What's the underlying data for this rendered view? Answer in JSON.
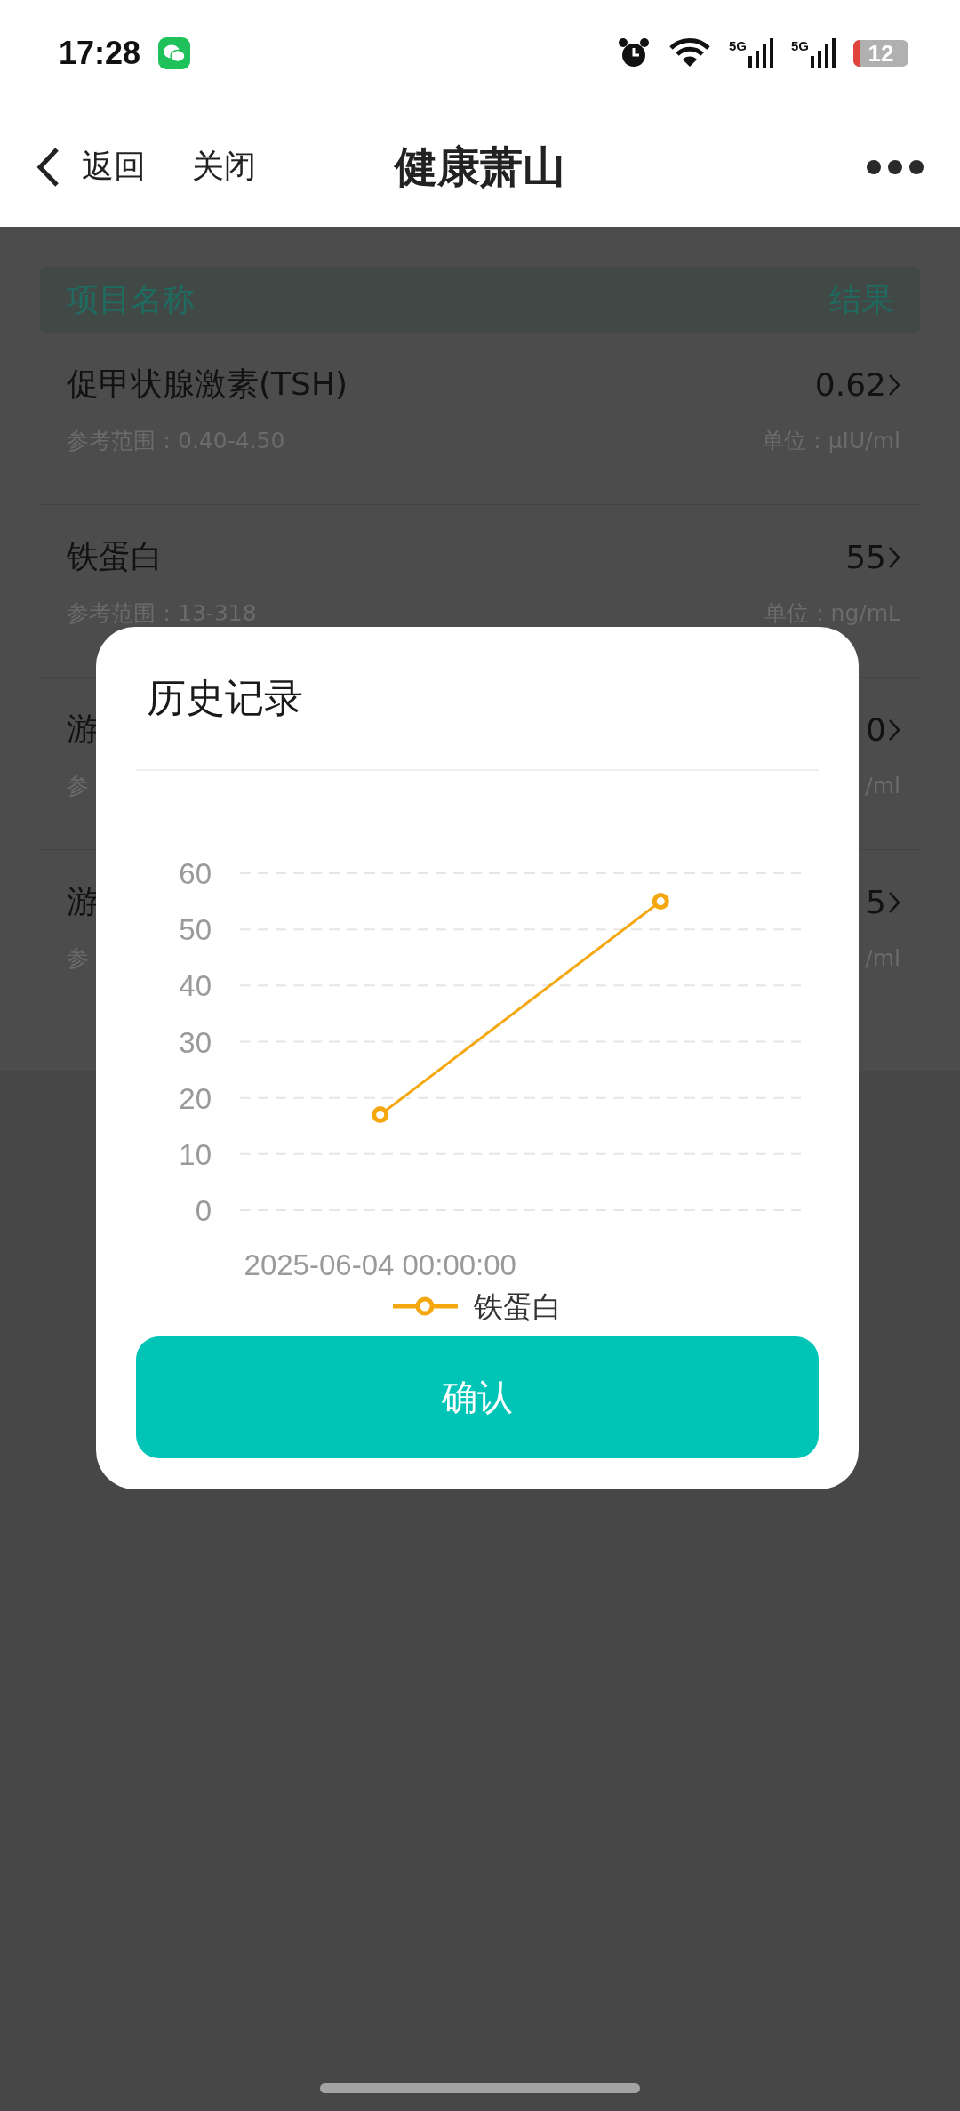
{
  "status_bar": {
    "time": "17:28",
    "network_labels": [
      "5G",
      "5G"
    ],
    "battery": "12"
  },
  "nav": {
    "back": "返回",
    "close": "关闭",
    "title": "健康萧山"
  },
  "table": {
    "columns": [
      "项目名称",
      "结果"
    ],
    "rows": [
      {
        "name": "促甲状腺激素(TSH)",
        "value": "0.62",
        "range": "参考范围：0.40-4.50",
        "unit": "单位：μIU/ml"
      },
      {
        "name": "铁蛋白",
        "value": "55",
        "range": "参考范围：13-318",
        "unit": "单位：ng/mL"
      },
      {
        "name": "游",
        "value": "0",
        "range": "参",
        "unit": "/ml"
      },
      {
        "name": "游",
        "value": "5",
        "range": "参",
        "unit": "/ml"
      }
    ]
  },
  "dialog": {
    "title": "历史记录",
    "chart_data": {
      "type": "line",
      "grid": true,
      "categories": [
        "2025-06-04 00:00:00",
        null
      ],
      "ylim": [
        0,
        60
      ],
      "yticks": [
        0,
        10,
        20,
        30,
        40,
        50,
        60
      ],
      "series": [
        {
          "name": "铁蛋白",
          "color": "#f5a70f",
          "marker": "circle",
          "values": [
            17,
            55
          ]
        }
      ]
    },
    "confirm": "确认"
  }
}
